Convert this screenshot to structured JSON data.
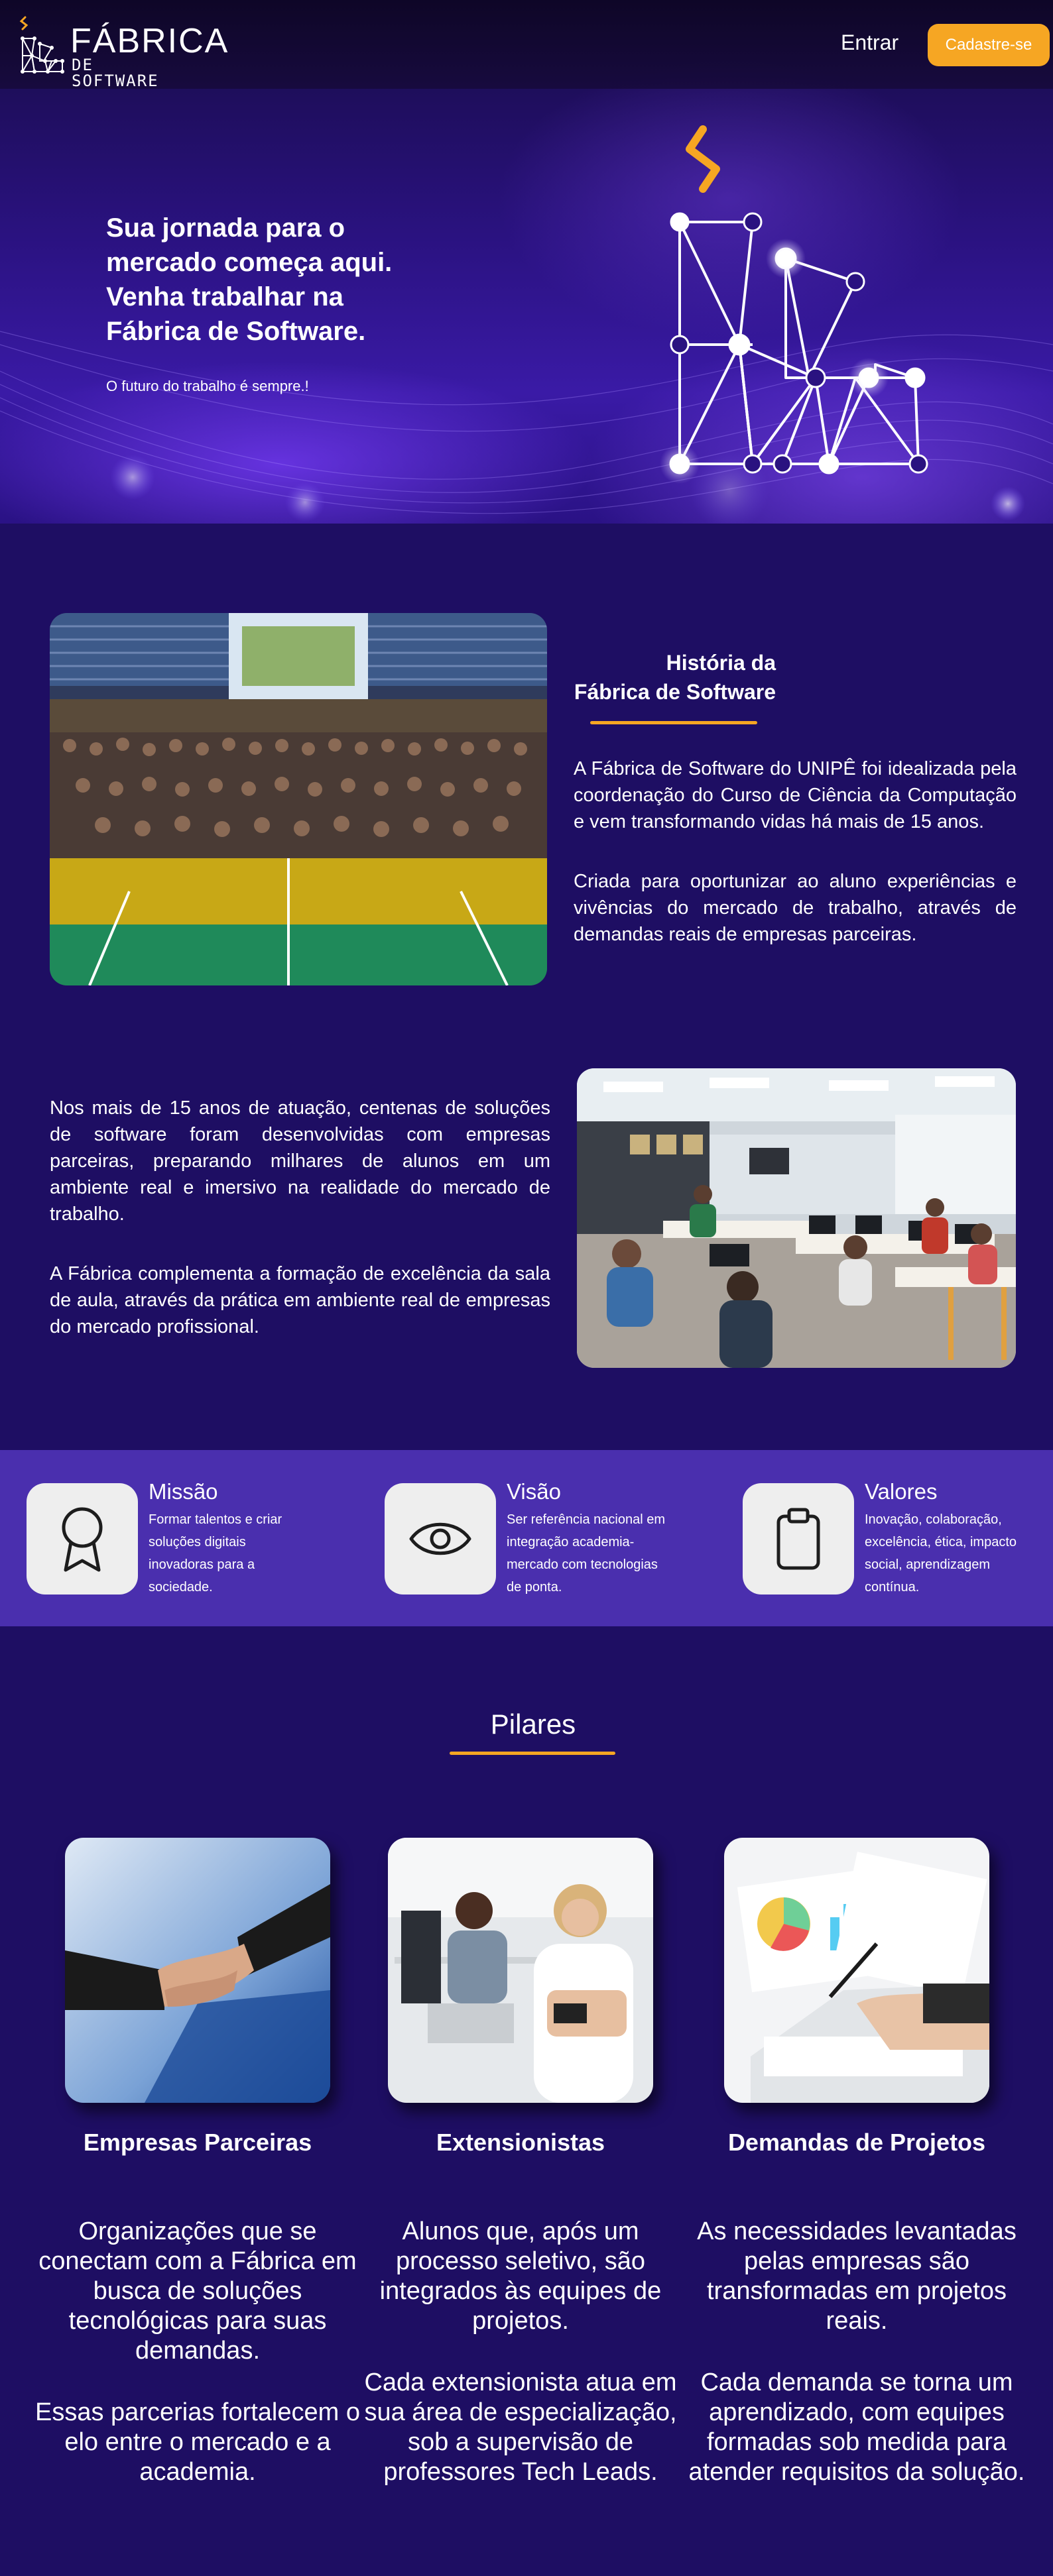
{
  "header": {
    "logo_title": "FÁBRICA",
    "logo_subtitle": "DE SOFTWARE",
    "login_label": "Entrar",
    "signup_label": "Cadastre-se"
  },
  "hero": {
    "title_lines": [
      "Sua jornada para o",
      "mercado começa aqui.",
      "Venha trabalhar na",
      "Fábrica de Software."
    ],
    "subtitle": "O futuro do trabalho é sempre.!"
  },
  "history": {
    "title_lines": [
      "História da",
      "Fábrica de Software"
    ],
    "paragraph_1": "A Fábrica de Software do UNIPÊ foi idealizada pela coordenação do Curso de Ciência da Computação e vem transformando vidas há mais de 15 anos.",
    "paragraph_2": "Criada para oportunizar ao aluno experiências e vivências do mercado de trabalho, através de demandas reais de empresas parceiras.",
    "paragraph_3": "Nos mais de 15 anos de atuação, centenas de soluções de software foram desenvolvidas com empresas parceiras, preparando milhares de alunos em um ambiente real e imersivo na realidade do mercado de trabalho.",
    "paragraph_4": "A Fábrica complementa a formação de excelência da sala de aula, através da prática em ambiente real de empresas do mercado profissional."
  },
  "mvv": [
    {
      "title": "Missão",
      "text": "Formar talentos e criar soluções digitais inovadoras para a sociedade.",
      "icon": "award-ribbon-icon"
    },
    {
      "title": "Visão",
      "text": "Ser referência nacional em integração academia-mercado com tecnologias de ponta.",
      "icon": "eye-icon"
    },
    {
      "title": "Valores",
      "text": "Inovação, colaboração, excelência, ética, impacto social, aprendizagem contínua.",
      "icon": "clipboard-icon"
    }
  ],
  "pillars": {
    "title": "Pilares",
    "items": [
      {
        "name": "Empresas Parceiras",
        "text_1": "Organizações que se conectam com a Fábrica em busca de soluções tecnológicas para suas demandas.",
        "text_2": "Essas parcerias fortalecem o elo entre o mercado e a academia."
      },
      {
        "name": "Extensionistas",
        "text_1": "Alunos que, após um processo seletivo, são integrados às equipes de projetos.",
        "text_2": "Cada extensionista atua em sua área de especialização, sob a supervisão de professores Tech Leads."
      },
      {
        "name": "Demandas de Projetos",
        "text_1": "As necessidades levantadas pelas empresas são transformadas em projetos reais.",
        "text_2": "Cada demanda se torna um aprendizado, com equipes formadas sob medida para atender requisitos da solução."
      }
    ]
  },
  "colors": {
    "background": "#1e0e63",
    "accent": "#f6a623",
    "band": "#4a2fae"
  }
}
